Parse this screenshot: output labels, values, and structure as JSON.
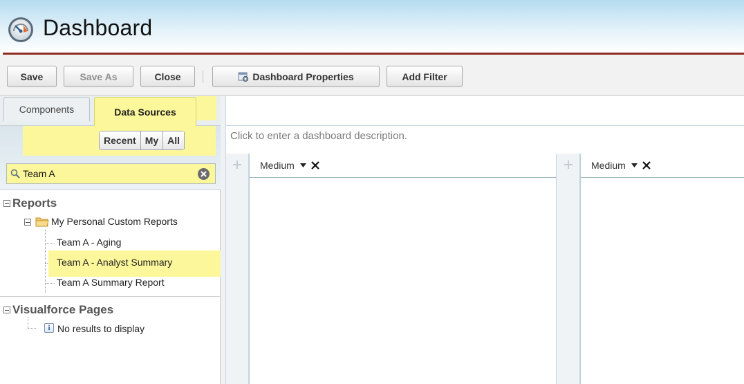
{
  "header": {
    "title": "Dashboard",
    "logo_icon": "dashboard-gauge-icon"
  },
  "toolbar": {
    "save_label": "Save",
    "save_as_label": "Save As",
    "close_label": "Close",
    "properties_label": "Dashboard Properties",
    "add_filter_label": "Add Filter"
  },
  "sidebar": {
    "tabs": [
      {
        "label": "Components",
        "active": false
      },
      {
        "label": "Data Sources",
        "active": true
      }
    ],
    "filter_buttons": [
      "Recent",
      "My",
      "All"
    ],
    "search": {
      "value": "Team A",
      "placeholder": ""
    },
    "reports": {
      "label": "Reports",
      "folder": "My Personal Custom Reports",
      "items": [
        "Team A - Aging",
        "Team A - Analyst Summary",
        "Team A Summary Report"
      ]
    },
    "visualforce": {
      "label": "Visualforce Pages",
      "empty_message": "No results to display"
    }
  },
  "canvas": {
    "description_placeholder": "Click to enter a dashboard description.",
    "columns": [
      {
        "size": "Medium"
      },
      {
        "size": "Medium"
      }
    ]
  },
  "colors": {
    "highlight": "#fcf79a",
    "header_rule": "#8e2b22",
    "header_gradient_top": "#b5dcef"
  }
}
